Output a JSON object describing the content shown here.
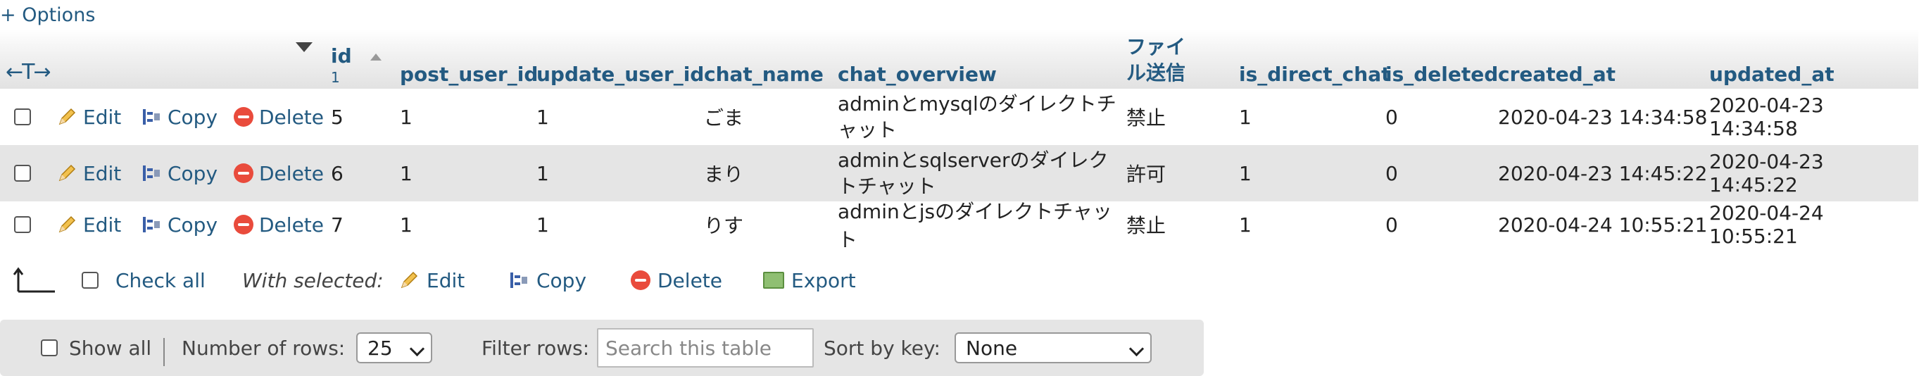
{
  "options_label": "+ Options",
  "columns": {
    "id": "id",
    "id_sub": "1",
    "post_user_id": "post_user_id",
    "update_user_id": "update_user_id",
    "chat_name": "chat_name",
    "chat_overview": "chat_overview",
    "file": "ファイル送信",
    "is_direct_chat": "is_direct_chat",
    "is_deleted": "is_deleted",
    "created_at": "created_at",
    "updated_at": "updated_at",
    "arrows": "←T→"
  },
  "row_actions": {
    "edit": "Edit",
    "copy": "Copy",
    "delete": "Delete"
  },
  "rows": [
    {
      "id": "5",
      "post_user_id": "1",
      "update_user_id": "1",
      "chat_name": "ごま",
      "chat_overview": "adminとmysqlのダイレクトチャット",
      "file": "禁止",
      "is_direct_chat": "1",
      "is_deleted": "0",
      "created_at": "2020-04-23 14:34:58",
      "updated_at": "2020-04-23 14:34:58"
    },
    {
      "id": "6",
      "post_user_id": "1",
      "update_user_id": "1",
      "chat_name": "まり",
      "chat_overview": "adminとsqlserverのダイレクトチャット",
      "file": "許可",
      "is_direct_chat": "1",
      "is_deleted": "0",
      "created_at": "2020-04-23 14:45:22",
      "updated_at": "2020-04-23 14:45:22"
    },
    {
      "id": "7",
      "post_user_id": "1",
      "update_user_id": "1",
      "chat_name": "りす",
      "chat_overview": "adminとjsのダイレクトチャット",
      "file": "禁止",
      "is_direct_chat": "1",
      "is_deleted": "0",
      "created_at": "2020-04-24 10:55:21",
      "updated_at": "2020-04-24 10:55:21"
    }
  ],
  "bulk": {
    "check_all": "Check all",
    "with_selected": "With selected:",
    "edit": "Edit",
    "copy": "Copy",
    "delete": "Delete",
    "export": "Export"
  },
  "navbar": {
    "show_all": "Show all",
    "number_of_rows_label": "Number of rows:",
    "number_of_rows_value": "25",
    "filter_rows_label": "Filter rows:",
    "filter_placeholder": "Search this table",
    "sort_by_key_label": "Sort by key:",
    "sort_by_key_value": "None"
  },
  "colors": {
    "link": "#235a81",
    "delete_icon": "#e94b3c",
    "row_alt": "#e5e5e5"
  }
}
